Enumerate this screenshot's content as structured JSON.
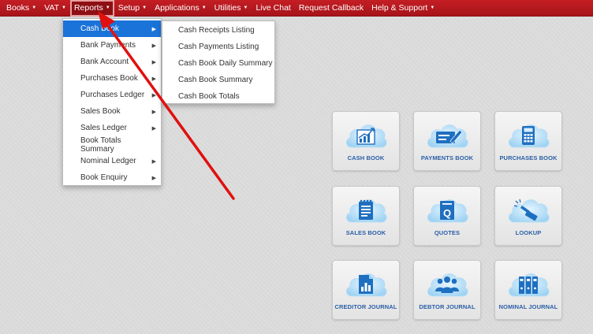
{
  "nav": {
    "items": [
      {
        "label": "Books",
        "caret": true
      },
      {
        "label": "VAT",
        "caret": true
      },
      {
        "label": "Reports",
        "caret": true,
        "active": true
      },
      {
        "label": "Setup",
        "caret": true
      },
      {
        "label": "Applications",
        "caret": true
      },
      {
        "label": "Utilities",
        "caret": true
      },
      {
        "label": "Live Chat",
        "caret": false
      },
      {
        "label": "Request Callback",
        "caret": false
      },
      {
        "label": "Help & Support",
        "caret": true
      }
    ]
  },
  "reports_menu": {
    "items": [
      {
        "label": "Cash Book",
        "submenu": true
      },
      {
        "label": "Bank Payments",
        "submenu": true
      },
      {
        "label": "Bank Account",
        "submenu": true
      },
      {
        "label": "Purchases Book",
        "submenu": true
      },
      {
        "label": "Purchases Ledger",
        "submenu": true
      },
      {
        "label": "Sales Book",
        "submenu": true
      },
      {
        "label": "Sales Ledger",
        "submenu": true
      },
      {
        "label": "Book Totals Summary",
        "submenu": false
      },
      {
        "label": "Nominal Ledger",
        "submenu": true
      },
      {
        "label": "Book Enquiry",
        "submenu": true
      }
    ]
  },
  "cash_book_submenu": {
    "items": [
      "Cash Receipts Listing",
      "Cash Payments Listing",
      "Cash Book Daily Summary",
      "Cash Book Summary",
      "Cash Book Totals"
    ]
  },
  "tiles": {
    "cash_book": "CASH BOOK",
    "payments_book": "PAYMENTS BOOK",
    "purchases_book": "PURCHASES BOOK",
    "sales_book": "SALES BOOK",
    "quotes": "QUOTES",
    "lookup": "LOOKUP",
    "creditor_journal": "CREDITOR JOURNAL",
    "debtor_journal": "DEBTOR JOURNAL",
    "nominal_journal": "NOMINAL JOURNAL"
  },
  "colors": {
    "navbar": "#b8181e",
    "active_menu": "#1a73d9",
    "tile_label": "#2a5fa8",
    "annotation_arrow": "#e01010"
  }
}
